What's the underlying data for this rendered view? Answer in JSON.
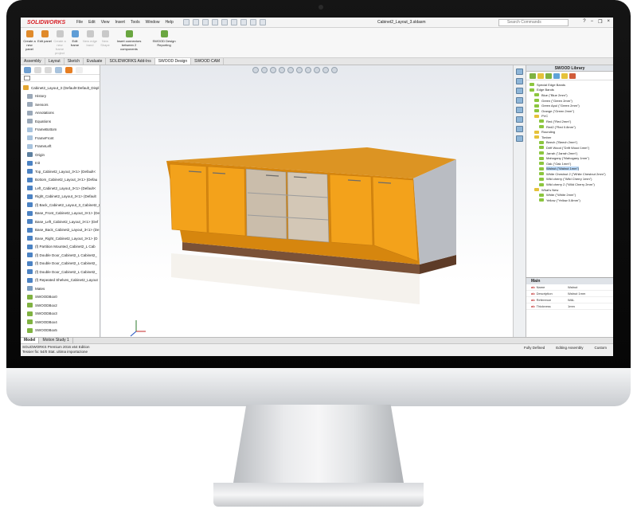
{
  "app": {
    "logo": "SOLIDWORKS",
    "menu": [
      "File",
      "Edit",
      "View",
      "Insert",
      "Tools",
      "Window",
      "Help"
    ],
    "document_title": "Cabinet2_Layout_3.sldasm",
    "search_placeholder": "Search Commands"
  },
  "ribbon": {
    "buttons": [
      {
        "label": "Create a new panel",
        "enabled": true
      },
      {
        "label": "Edit panel",
        "enabled": true
      },
      {
        "label": "Create a new frame project",
        "enabled": false
      },
      {
        "label": "Edit frame",
        "enabled": true
      },
      {
        "label": "New edge band",
        "enabled": false
      },
      {
        "label": "New Shape",
        "enabled": false
      },
      {
        "label": "Insert connectors between 2 components",
        "enabled": true
      },
      {
        "label": "SWOOD Design Reporting",
        "enabled": true
      }
    ]
  },
  "tabs": [
    "Assembly",
    "Layout",
    "Sketch",
    "Evaluate",
    "SOLIDWORKS Add-Ins",
    "SWOOD Design",
    "SWOOD CAM"
  ],
  "tabs_active": "SWOOD Design",
  "feature_tree": [
    {
      "label": "Cabinet2_Layout_3 (Default<Default_Displ",
      "level": 0,
      "icon": "assembly-icon"
    },
    {
      "label": "History",
      "level": 1,
      "icon": "history-icon"
    },
    {
      "label": "Sensors",
      "level": 1,
      "icon": "sensor-icon"
    },
    {
      "label": "Annotations",
      "level": 1,
      "icon": "annotation-icon"
    },
    {
      "label": "Equations",
      "level": 1,
      "icon": "equation-icon"
    },
    {
      "label": "FrameBottom",
      "level": 1,
      "icon": "plane-icon"
    },
    {
      "label": "FrameFront",
      "level": 1,
      "icon": "plane-icon"
    },
    {
      "label": "FrameLeft",
      "level": 1,
      "icon": "plane-icon"
    },
    {
      "label": "Origin",
      "level": 1,
      "icon": "origin-icon"
    },
    {
      "label": "Init",
      "level": 1,
      "icon": "part-icon"
    },
    {
      "label": "Top_Cabinet2_Layout_3<1> (Default<",
      "level": 1,
      "icon": "part-icon"
    },
    {
      "label": "Bottom_Cabinet2_Layout_3<1> (Defau",
      "level": 1,
      "icon": "part-icon"
    },
    {
      "label": "Left_Cabinet2_Layout_3<1> (Default<",
      "level": 1,
      "icon": "part-icon"
    },
    {
      "label": "Right_Cabinet2_Layout_3<1> (Default",
      "level": 1,
      "icon": "part-icon"
    },
    {
      "label": "(f) Back_Cabinet2_Layout_3_Cabinet2_Layout_3",
      "level": 1,
      "icon": "part-icon"
    },
    {
      "label": "Base_Front_Cabinet2_Layout_3<1> (De",
      "level": 1,
      "icon": "part-icon"
    },
    {
      "label": "Base_Left_Cabinet2_Layout_3<1> (Def",
      "level": 1,
      "icon": "part-icon"
    },
    {
      "label": "Base_Back_Cabinet2_Layout_3<1> (De",
      "level": 1,
      "icon": "part-icon"
    },
    {
      "label": "Base_Right_Cabinet2_Layout_3<1> (D",
      "level": 1,
      "icon": "part-icon"
    },
    {
      "label": "(f) Partition Mounted_Cabinet2_L Cab",
      "level": 1,
      "icon": "part-icon"
    },
    {
      "label": "(f) Double Door_Cabinet2_L Cabinet2_",
      "level": 1,
      "icon": "part-icon"
    },
    {
      "label": "(f) Double Door_Cabinet2_L Cabinet2_",
      "level": 1,
      "icon": "part-icon"
    },
    {
      "label": "(f) Double Door_Cabinet2_L Cabinet2_",
      "level": 1,
      "icon": "part-icon"
    },
    {
      "label": "(f) Repeated Shelves_Cabinet2_Layout",
      "level": 1,
      "icon": "part-icon"
    },
    {
      "label": "Mates",
      "level": 1,
      "icon": "mates-icon"
    },
    {
      "label": "SWOODBox0",
      "level": 1,
      "icon": "swood-box-icon"
    },
    {
      "label": "SWOODBox2",
      "level": 1,
      "icon": "swood-box-icon"
    },
    {
      "label": "SWOODBox3",
      "level": 1,
      "icon": "swood-box-icon"
    },
    {
      "label": "SWOODBox4",
      "level": 1,
      "icon": "swood-box-icon"
    },
    {
      "label": "SWOODBox5",
      "level": 1,
      "icon": "swood-box-icon"
    }
  ],
  "library": {
    "title": "SWOOD Library",
    "items": [
      {
        "label": "Special Edge Bands",
        "level": 0,
        "selected": false
      },
      {
        "label": "Edge Bands",
        "level": 0,
        "selected": false
      },
      {
        "label": "Blue (\"Blue 2mm\")",
        "level": 1,
        "selected": false
      },
      {
        "label": "Green (\"Green 2mm\")",
        "level": 1,
        "selected": false
      },
      {
        "label": "Green Apul (\"Green 2mm\")",
        "level": 1,
        "selected": false
      },
      {
        "label": "Orange (\"Green 2mm\")",
        "level": 1,
        "selected": false
      },
      {
        "label": "PVC",
        "level": 1,
        "selected": false
      },
      {
        "label": "Red (\"Red 2mm\")",
        "level": 2,
        "selected": false
      },
      {
        "label": "Red2 (\"Red 0.8mm\")",
        "level": 2,
        "selected": false
      },
      {
        "label": "Rounding",
        "level": 1,
        "selected": false
      },
      {
        "label": "Timber",
        "level": 1,
        "selected": false
      },
      {
        "label": "Beech (\"Beech 2mm\")",
        "level": 2,
        "selected": false
      },
      {
        "label": "Drift Wood (\"Drift Wood 1mm\")",
        "level": 2,
        "selected": false
      },
      {
        "label": "Jarrah (\"Jarrah 2mm\")",
        "level": 2,
        "selected": false
      },
      {
        "label": "Mahogany (\"Mahogany 1mm\")",
        "level": 2,
        "selected": false
      },
      {
        "label": "Oak (\"Oak 1mm\")",
        "level": 2,
        "selected": false
      },
      {
        "label": "Walnut (\"Walnut 1mm\")",
        "level": 2,
        "selected": true
      },
      {
        "label": "White Chestnut 2 (\"White Chestnut 2mm\")",
        "level": 2,
        "selected": false
      },
      {
        "label": "Wild cherry (\"Wild Cherry 1mm\")",
        "level": 2,
        "selected": false
      },
      {
        "label": "Wild cherry 2 (\"Wild Cherry 2mm\")",
        "level": 2,
        "selected": false
      },
      {
        "label": "What's New",
        "level": 1,
        "selected": false
      },
      {
        "label": "White (\"White 2mm\")",
        "level": 2,
        "selected": false
      },
      {
        "label": "Yellow (\"Yellow 0.8mm\")",
        "level": 2,
        "selected": false
      }
    ]
  },
  "properties": {
    "title": "Main",
    "rows": [
      {
        "key": "Name",
        "value": "Walnut"
      },
      {
        "key": "Description",
        "value": "Walnut 1mm"
      },
      {
        "key": "Reference",
        "value": "WAL"
      },
      {
        "key": "Thickness",
        "value": "1mm"
      }
    ]
  },
  "bottom_tabs": [
    "Model",
    "Motion Study 1"
  ],
  "bottom_tabs_active": "Model",
  "status": {
    "left_line1": "SOLIDWORKS Premium 2016 x64 Edition",
    "left_line2": "Tessier fix: 54/0 Stat. ultima importazione",
    "fully_defined": "Fully Defined",
    "editing": "Editing Assembly",
    "units": "Custom"
  },
  "colors": {
    "door": "#f3a21b",
    "door_dark": "#d6860e",
    "carcass_side": "#b9bcc2",
    "plinth": "#7a5137",
    "accent_red": "#d71f26"
  }
}
